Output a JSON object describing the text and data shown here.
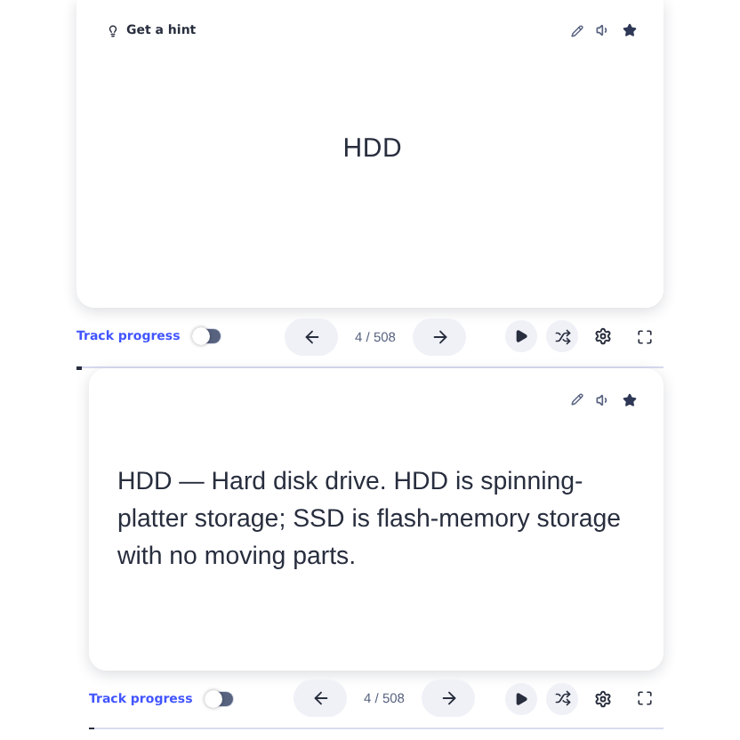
{
  "views": [
    {
      "kind": "term",
      "hint": "Get a hint",
      "text": "HDD",
      "starred": true,
      "track_progress": {
        "label": "Track progress",
        "on": false
      },
      "counter": "4 / 508",
      "progress": {
        "level": 0.01
      }
    },
    {
      "kind": "definition",
      "text": "HDD — Hard disk drive. HDD is spinning-platter storage; SSD is flash-memory storage with no moving parts.",
      "starred": true,
      "track_progress": {
        "label": "Track progress",
        "on": false
      },
      "counter": "4 / 508",
      "progress": {
        "level": 0.01
      }
    }
  ]
}
